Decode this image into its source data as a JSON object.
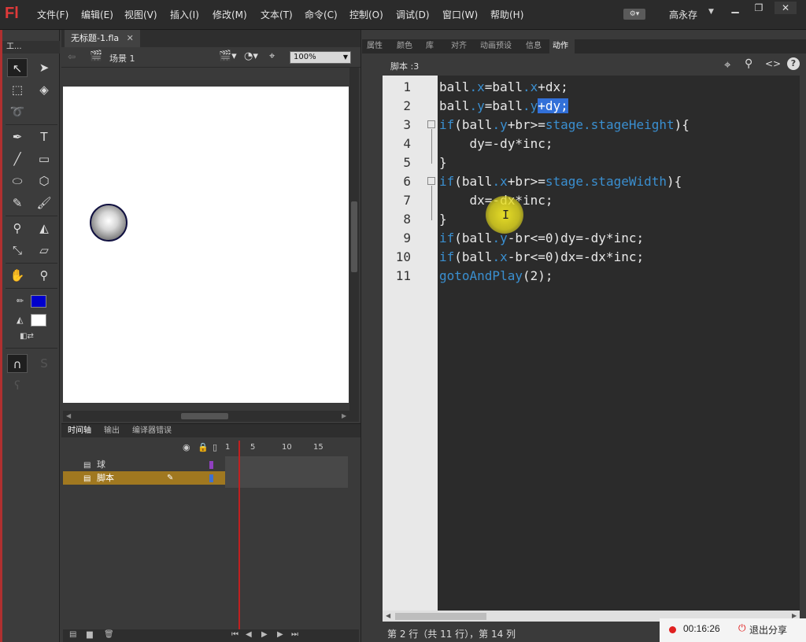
{
  "app": {
    "logo": "Fl"
  },
  "menu": [
    "文件(F)",
    "编辑(E)",
    "视图(V)",
    "插入(I)",
    "修改(M)",
    "文本(T)",
    "命令(C)",
    "控制(O)",
    "调试(D)",
    "窗口(W)",
    "帮助(H)"
  ],
  "user": {
    "name": "高永存"
  },
  "tools_panel": {
    "title": "工..."
  },
  "document": {
    "tab": "无标题-1.fla",
    "scene": "场景 1",
    "zoom": "100%"
  },
  "timeline": {
    "tabs": [
      "时间轴",
      "输出",
      "编译器错误"
    ],
    "ruler": [
      "1",
      "5",
      "10",
      "15"
    ],
    "layers": [
      {
        "name": "球"
      },
      {
        "name": "脚本"
      }
    ]
  },
  "right_panel": {
    "tabs": [
      "属性",
      "颜色",
      "库",
      "对齐",
      "动画预设",
      "信息",
      "动作"
    ],
    "active_tab": "动作",
    "script_label": "脚本 :3"
  },
  "code": {
    "lines": [
      "1",
      "2",
      "3",
      "4",
      "5",
      "6",
      "7",
      "8",
      "9",
      "10",
      "11"
    ]
  },
  "status": {
    "position": "第 2 行（共 11 行），第 14 列"
  },
  "recorder": {
    "time": "00:16:26",
    "exit_label": "退出分享"
  },
  "colors": {
    "stroke": "#0000cc",
    "fill": "#ffffff",
    "highlight": "#3270d8",
    "keyword": "#3a8fd0"
  }
}
